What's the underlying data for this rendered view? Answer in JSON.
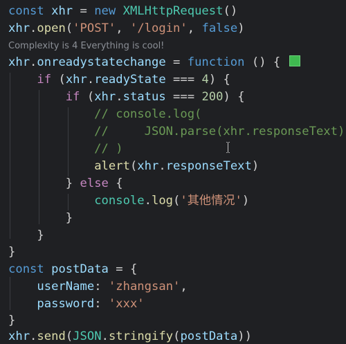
{
  "code": {
    "l1": [
      "const",
      " ",
      "xhr",
      " = ",
      "new",
      " ",
      "XMLHttpRequest",
      "()"
    ],
    "l2": [
      "xhr",
      ".",
      "open",
      "(",
      "'POST'",
      ", ",
      "'/login'",
      ", ",
      "false",
      ")"
    ],
    "codelens": "Complexity is 4 Everything is cool!",
    "l3": [
      "xhr",
      ".",
      "onreadystatechange",
      " = ",
      "function",
      " () {"
    ],
    "l4": [
      "    ",
      "if",
      " (",
      "xhr",
      ".",
      "readyState",
      " === ",
      "4",
      ") {"
    ],
    "l5": [
      "        ",
      "if",
      " (",
      "xhr",
      ".",
      "status",
      " === ",
      "200",
      ") {"
    ],
    "l6": "            // console.log(",
    "l7": "            //     JSON.parse(xhr.responseText)",
    "l8": "            // )",
    "l9": [
      "            ",
      "alert",
      "(",
      "xhr",
      ".",
      "responseText",
      ")"
    ],
    "l10": [
      "        ",
      "} ",
      "else",
      " {"
    ],
    "l11": [
      "            ",
      "console",
      ".",
      "log",
      "(",
      "'其他情况'",
      ")"
    ],
    "l12": "        }",
    "l13": "    }",
    "l14": "}",
    "l15": [
      "const",
      " ",
      "postData",
      " = {"
    ],
    "l16": [
      "    ",
      "userName",
      ": ",
      "'zhangsan'",
      ","
    ],
    "l17": [
      "    ",
      "password",
      ": ",
      "'xxx'"
    ],
    "l18": "}",
    "l19": [
      "xhr",
      ".",
      "send",
      "(",
      "JSON",
      ".",
      "stringify",
      "(",
      "postData",
      "))"
    ]
  },
  "colors": {
    "background": "#1f2023",
    "keyword": "#569cd6",
    "control": "#c586c0",
    "variable": "#9cdcfe",
    "class": "#4ec9b0",
    "function": "#dcdcaa",
    "string": "#ce9178",
    "number": "#b5cea8",
    "comment": "#6a9955",
    "swatch": "#3fb950"
  },
  "icons": {
    "color_swatch": "green-square-icon",
    "cursor": "text-cursor-icon"
  }
}
